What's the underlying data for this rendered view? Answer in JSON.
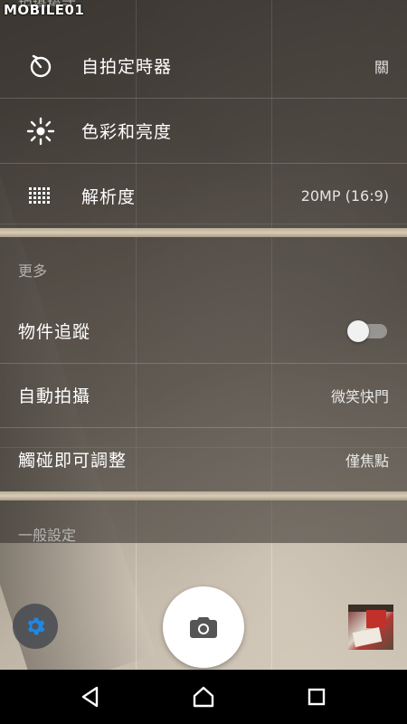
{
  "watermark": "MOBILE01",
  "menu": {
    "truncated_header": "拍攝模式",
    "rows": [
      {
        "label": "自拍定時器",
        "value": "關",
        "icon": "timer-icon"
      },
      {
        "label": "色彩和亮度",
        "value": "",
        "icon": "brightness-icon"
      },
      {
        "label": "解析度",
        "value": "20MP (16:9)",
        "icon": "resolution-icon"
      }
    ],
    "more_section": "更多",
    "more_rows": [
      {
        "label": "物件追蹤",
        "type": "toggle",
        "on": false
      },
      {
        "label": "自動拍攝",
        "value": "微笑快門"
      },
      {
        "label": "觸碰即可調整",
        "value": "僅焦點"
      }
    ],
    "general_section": "一般設定"
  },
  "controls": {
    "settings_icon": "gear-icon",
    "shutter_icon": "camera-icon",
    "thumbnail": "last-photo-thumbnail"
  },
  "navbar": {
    "back": "back-icon",
    "home": "home-icon",
    "recents": "recents-icon"
  },
  "colors": {
    "accent": "#1e88e5",
    "toggle_off_track": "#9e9e9e"
  }
}
